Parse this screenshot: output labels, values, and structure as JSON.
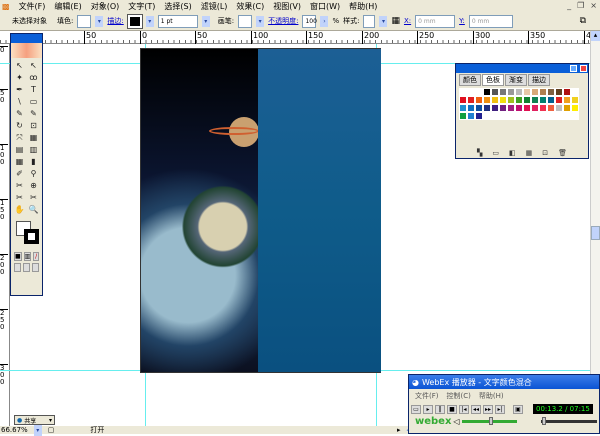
{
  "menu": [
    "文件(F)",
    "编辑(E)",
    "对象(O)",
    "文字(T)",
    "选择(S)",
    "滤镜(L)",
    "效果(C)",
    "视图(V)",
    "窗口(W)",
    "帮助(H)"
  ],
  "window_controls": [
    "_",
    "❐",
    "×"
  ],
  "control_bar": {
    "selection": "未选择对象",
    "fill_label": "填色:",
    "stroke_label": "描边:",
    "stroke_weight": "1 pt",
    "brush_label": "画笔:",
    "opacity_label": "不透明度:",
    "opacity_value": "100",
    "opacity_unit": "%",
    "style_label": "样式:",
    "x_label": "X:",
    "x_value": "0 mm",
    "y_label": "Y:",
    "y_value": "0 mm"
  },
  "ruler_h": [
    "50",
    "0",
    "50",
    "100",
    "150",
    "200",
    "250",
    "300",
    "350",
    "4"
  ],
  "ruler_v": [
    "0",
    "5 0",
    "1 0 0",
    "1 5 0",
    "2 0 0",
    "2 5 0",
    "3 0 0"
  ],
  "tools": [
    "↖",
    "↖",
    "✦",
    "ꝏ",
    "✒",
    "T",
    "\\",
    "▭",
    "✎",
    "✎",
    "↻",
    "⊡",
    "⤧",
    "▦",
    "▤",
    "▥",
    "▦",
    "▮",
    "✐",
    "⚲",
    "✂",
    "⊕",
    "✂",
    "✂",
    "✋",
    "🔍"
  ],
  "swatches_panel": {
    "tabs": [
      "颜色",
      "色板",
      "渐变",
      "描边"
    ],
    "active_tab": "色板",
    "colors": [
      "#ffffff",
      "#ffffff",
      "#ffffff",
      "#000000",
      "#555555",
      "#777777",
      "#999999",
      "#bbbbbb",
      "#e8c8a8",
      "#d8a878",
      "#b08050",
      "#806040",
      "#604020",
      "#b01010",
      "#ffffff",
      "#e01020",
      "#e02020",
      "#f06010",
      "#f09010",
      "#f0c010",
      "#f0e010",
      "#a0c020",
      "#40a020",
      "#108030",
      "#108050",
      "#008070",
      "#006090",
      "#e02020",
      "#f0a020",
      "#f0d020",
      "#2090d0",
      "#1070c0",
      "#1050a0",
      "#203080",
      "#402080",
      "#702080",
      "#a02080",
      "#c01070",
      "#e01050",
      "#e02060",
      "#f03050",
      "#f06040",
      "#c0c0c0",
      "#e0a000",
      "#ffee00",
      "#10a040",
      "#2080d0",
      "#202090"
    ]
  },
  "status": {
    "zoom": "66.67%",
    "mode": "打开"
  },
  "share_label": "共享",
  "webex": {
    "title": "WebEx 播放器 - 文字颜色混合",
    "menu": [
      "文件(F)",
      "控制(C)",
      "帮助(H)"
    ],
    "time": "00:13.2 / 07:15",
    "brand": "webex"
  }
}
